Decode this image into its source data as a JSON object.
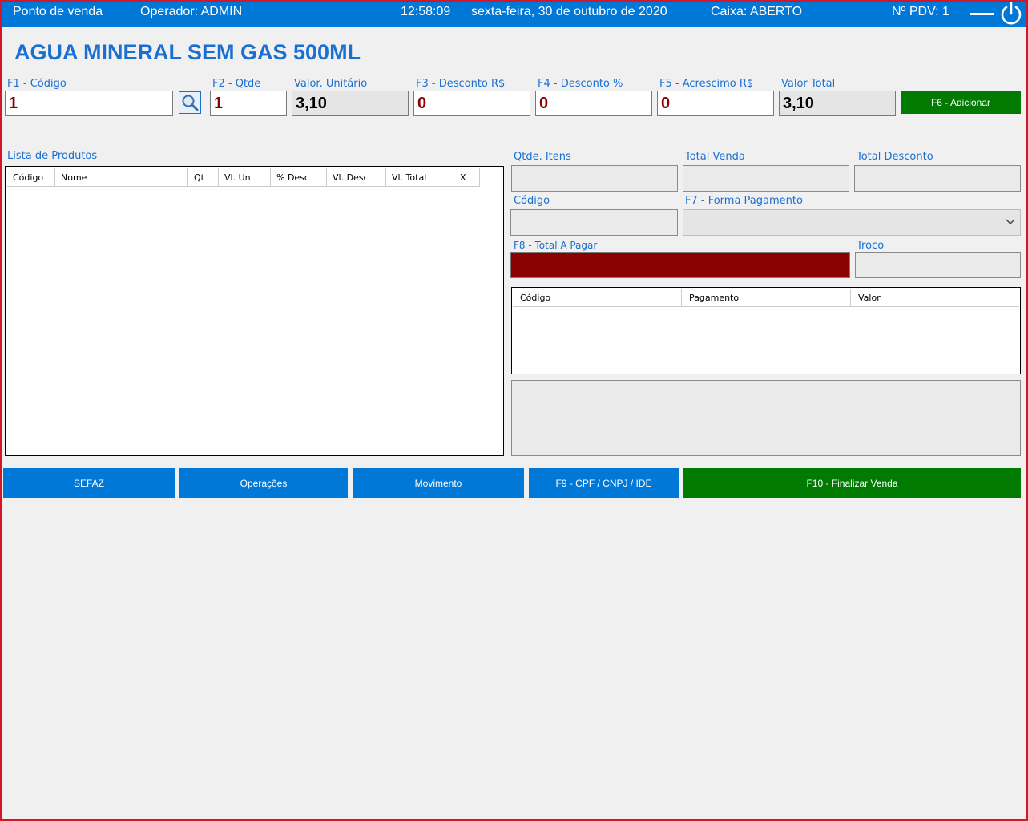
{
  "topbar": {
    "app_name": "Ponto de venda",
    "operator": "Operador: ADMIN",
    "time": "12:58:09",
    "date": "sexta-feira, 30 de outubro de 2020",
    "cash_status": "Caixa: ABERTO",
    "pdv": "Nº PDV: 1"
  },
  "product": {
    "name": "AGUA MINERAL SEM GAS 500ML"
  },
  "entry": {
    "code_label": "F1 - Código",
    "code_value": "1",
    "qty_label": "F2 - Qtde",
    "qty_value": "1",
    "unit_label": "Valor. Unitário",
    "unit_value": "3,10",
    "disc_value_label": "F3 - Desconto R$",
    "disc_value": "0",
    "disc_pct_label": "F4 - Desconto  %",
    "disc_pct": "0",
    "increase_label": "F5 - Acrescimo R$",
    "increase_value": "0",
    "total_label": "Valor Total",
    "total_value": "3,10",
    "add_button": "F6 - Adicionar"
  },
  "products_list": {
    "label": "Lista de Produtos",
    "columns": [
      "Código",
      "Nome",
      "Qt",
      "Vl. Un",
      "% Desc",
      "Vl. Desc",
      "Vl. Total",
      "X"
    ]
  },
  "summary": {
    "items_label": "Qtde. Itens",
    "total_sale_label": "Total Venda",
    "total_discount_label": "Total Desconto",
    "code_label": "Código",
    "payment_method_label": "F7 - Forma Pagamento",
    "total_to_pay_label": "F8 - Total A Pagar",
    "change_label": "Troco"
  },
  "payments": {
    "columns": [
      "Código",
      "Pagamento",
      "Valor"
    ]
  },
  "buttons": {
    "sefaz": "SEFAZ",
    "operations": "Operações",
    "movement": "Movimento",
    "cpf": "F9 - CPF / CNPJ / IDE",
    "finish": "F10 - Finalizar Venda"
  },
  "colors": {
    "accent": "#0078d7",
    "label": "#1a6fd1",
    "success": "#007a00",
    "danger": "#8b0000"
  },
  "icons": {
    "search": "search-icon",
    "power": "power-icon",
    "minimize": "minimize-icon"
  }
}
